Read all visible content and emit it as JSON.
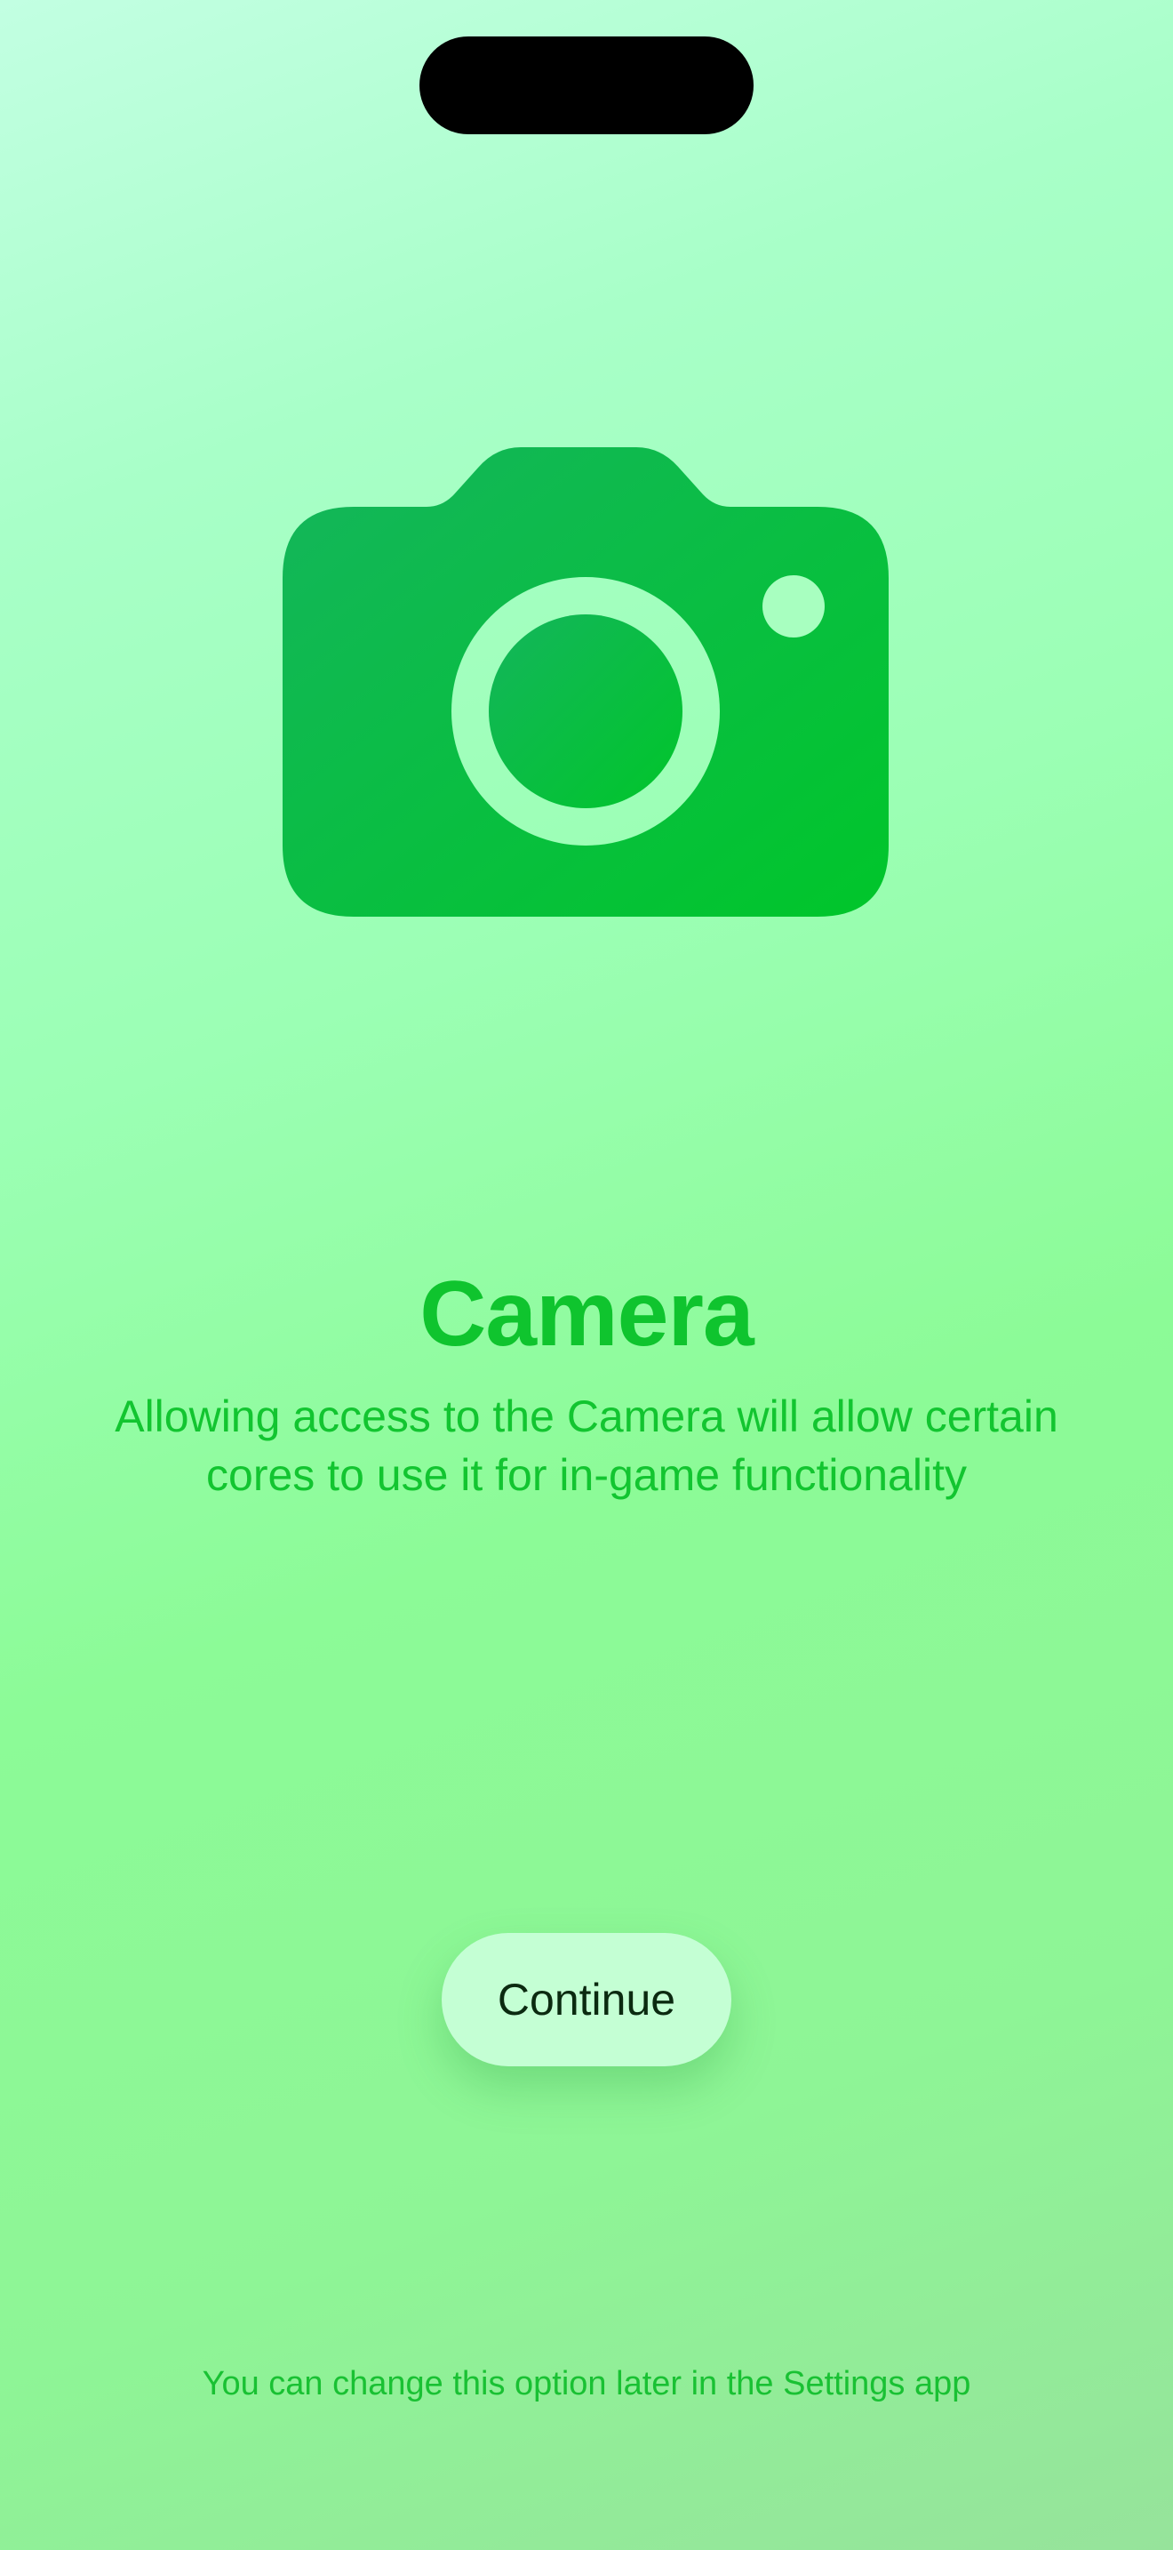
{
  "screen": {
    "icon": "camera-icon",
    "title": "Camera",
    "description": "Allowing access to the Camera will allow certain cores to use it for in-game functionality",
    "continue_label": "Continue",
    "footnote": "You can change this option later in the Settings app"
  },
  "colors": {
    "accent": "#0fc42e",
    "icon_gradient_start": "#14b55c",
    "icon_gradient_end": "#00c62a",
    "button_background": "#c4ffd4",
    "button_text": "#0b2a10"
  }
}
